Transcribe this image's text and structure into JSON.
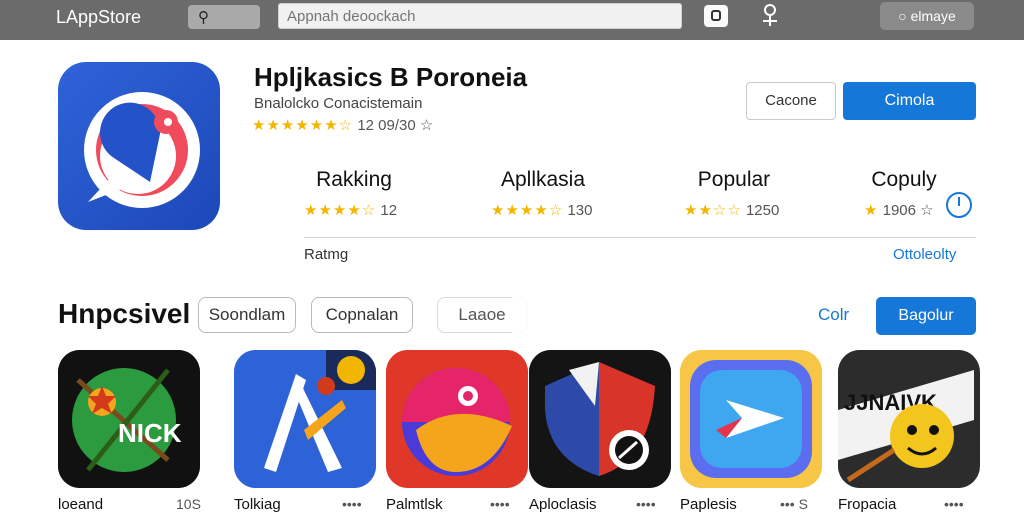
{
  "topbar": {
    "brand": "LAppStore",
    "search_placeholder": "Appnah deoockach",
    "user_label": "○ elmaye"
  },
  "app": {
    "title": "Hpljkasics B Poroneia",
    "developer": "Bnalolcko Conacistemain",
    "stars": "★★★★★★☆",
    "rating_text": "12 09/30 ☆",
    "secondary_button": "Cacone",
    "primary_button": "Cimola"
  },
  "stats": [
    {
      "label": "Rakking",
      "stars": "★★★★☆",
      "value": "12"
    },
    {
      "label": "Apllkasia",
      "stars": "★★★★☆",
      "value": "130"
    },
    {
      "label": "Popular",
      "stars": "★★☆☆",
      "value": "1250"
    },
    {
      "label": "Copuly",
      "stars": "★",
      "value": "1906 ☆"
    }
  ],
  "rating_label": "Ratmg",
  "all_link": "Ottoleolty",
  "section": {
    "title": "Hnpcsivel",
    "chips": [
      "Soondlam",
      "Copnalan",
      "Laaoe"
    ],
    "see_all": "Colr",
    "view_button": "Bagolur"
  },
  "tiles": [
    {
      "name": "loeand",
      "meta": "10S",
      "text": "NICK"
    },
    {
      "name": "Tolkiag",
      "meta": "••••"
    },
    {
      "name": "Palmtlsk",
      "meta": "••••"
    },
    {
      "name": "Aploclasis",
      "meta": "••••"
    },
    {
      "name": "Paplesis",
      "meta": "••• S"
    },
    {
      "name": "Fropacia",
      "meta": "••••",
      "text": "JJNAIVK"
    }
  ],
  "colors": {
    "accent": "#1577d8",
    "topbar": "#6b6b6b",
    "star": "#f2b600"
  }
}
